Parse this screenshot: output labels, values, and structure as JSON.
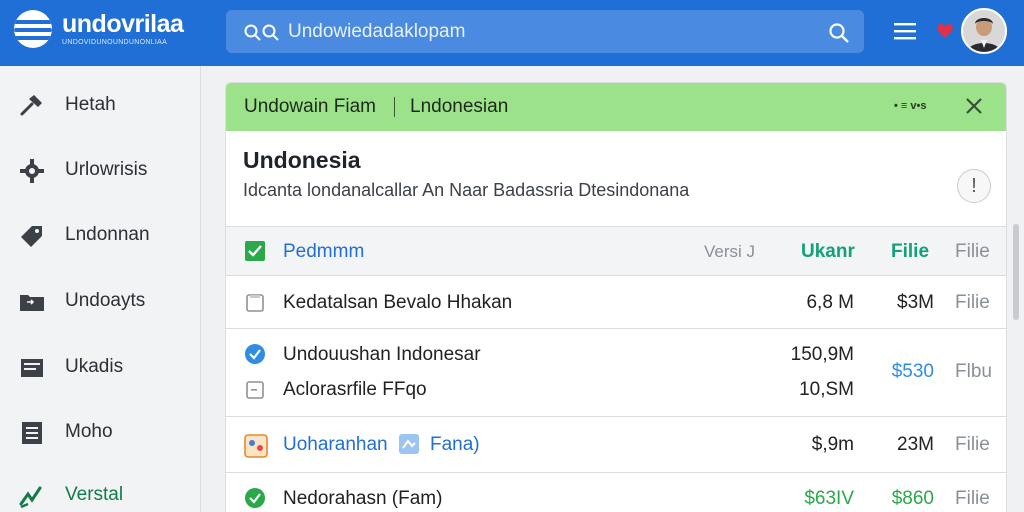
{
  "header": {
    "brand_title": "undovrilaa",
    "brand_sub": "UNDOVIDUNOUNDUNONLIAA",
    "search_placeholder": "Undowiedadaklopam",
    "colors": {
      "header": "#1f6fd6",
      "accent": "#137a4a",
      "banner": "#9be28a"
    }
  },
  "sidebar": {
    "items": [
      {
        "label": "Hetah",
        "icon": "hammer-icon"
      },
      {
        "label": "Urlowrisis",
        "icon": "gear-icon"
      },
      {
        "label": "Lndonnan",
        "icon": "tag-icon"
      },
      {
        "label": "Undoayts",
        "icon": "folder-icon"
      },
      {
        "label": "Ukadis",
        "icon": "inbox-icon"
      },
      {
        "label": "Moho",
        "icon": "document-icon"
      },
      {
        "label": "Verstal",
        "icon": "chart-icon",
        "active": true
      }
    ]
  },
  "banner": {
    "left": "Undowain Fiam",
    "right": "Lndonesian",
    "meta": "• ≡ v•s"
  },
  "card": {
    "title": "Undonesia",
    "description": "Idcanta londanalcallar An Naar Badassria Dtesindonana",
    "info_label": "!"
  },
  "table": {
    "header": {
      "name": "Pedmmm",
      "version": "Versi J",
      "col_a": "Ukanr",
      "col_b": "Filie",
      "col_c": "Filie"
    },
    "rows": [
      {
        "name": "Kedatalsan Bevalo Hhakan",
        "a": "6,8 M",
        "b": "$3M",
        "c": "Filie",
        "icon": "file-icon"
      },
      {
        "name": "Undouushan Indonesar",
        "a": "150,9M",
        "b": "",
        "c": "",
        "icon": "check-circle-icon"
      },
      {
        "name": "Aclorasrfile FFqo",
        "a": "10,SM",
        "b": "$530",
        "c": "Flbu",
        "icon": "file-icon"
      },
      {
        "name": "Uoharanhan",
        "tag": "Fana)",
        "a": "$,9m",
        "b": "23M",
        "c": "Filie",
        "icon": "image-icon"
      },
      {
        "name": "Nedorahasn (Fam)",
        "a": "$63IV",
        "b": "$860",
        "c": "Filie",
        "icon": "check-circle-icon"
      }
    ]
  }
}
